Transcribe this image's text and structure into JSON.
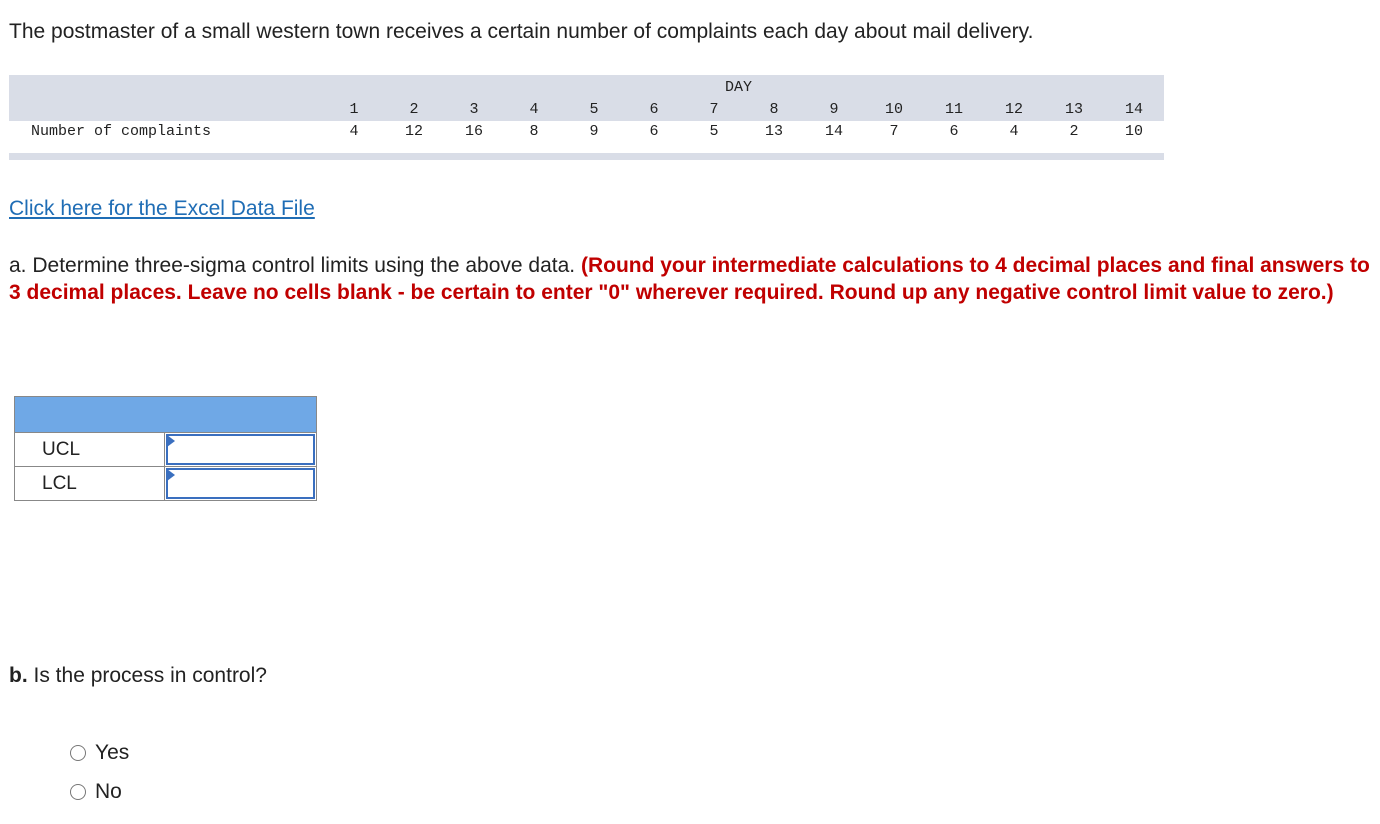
{
  "intro": "The postmaster of a small western town receives a certain number of complaints each day about mail delivery.",
  "data_table": {
    "group_header": "DAY",
    "days": [
      "1",
      "2",
      "3",
      "4",
      "5",
      "6",
      "7",
      "8",
      "9",
      "10",
      "11",
      "12",
      "13",
      "14"
    ],
    "row_label": "Number of complaints",
    "values": [
      "4",
      "12",
      "16",
      "8",
      "9",
      "6",
      "5",
      "13",
      "14",
      "7",
      "6",
      "4",
      "2",
      "10"
    ]
  },
  "link_text": "Click here for the Excel Data File",
  "question_a": {
    "prefix": "a. Determine three-sigma control limits using the above data. ",
    "instruction": "(Round your intermediate calculations to 4 decimal places and final answers to 3 decimal places. Leave no cells blank - be certain to enter \"0\" wherever required. Round up any negative control limit value to zero.)"
  },
  "answer_table": {
    "rows": [
      {
        "label": "UCL",
        "value": ""
      },
      {
        "label": "LCL",
        "value": ""
      }
    ]
  },
  "question_b": {
    "bold": "b.",
    "text": " Is the process in control?",
    "options": [
      "Yes",
      "No"
    ]
  }
}
